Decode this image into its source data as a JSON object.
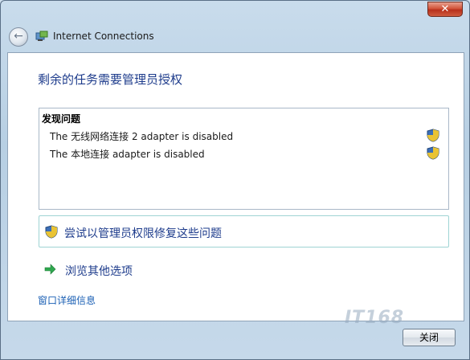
{
  "window": {
    "title": "Internet Connections",
    "close_symbol": "✕"
  },
  "heading": "剩余的任务需要管理员授权",
  "problems": {
    "header": "发现问题",
    "items": [
      {
        "text": "The 无线网络连接 2 adapter is disabled",
        "icon": "shield-icon"
      },
      {
        "text": "The 本地连接 adapter is disabled",
        "icon": "shield-icon"
      }
    ]
  },
  "action": {
    "label": "尝试以管理员权限修复这些问题",
    "icon": "shield-icon"
  },
  "browse": {
    "label": "浏览其他选项",
    "icon": "green-arrow-icon"
  },
  "details_link": "窗口详细信息",
  "footer": {
    "close_label": "关闭"
  },
  "watermark": "IT168",
  "colors": {
    "heading": "#1e3c8c",
    "link": "#1a5fb4",
    "accent_arrow": "#2fa84f"
  }
}
